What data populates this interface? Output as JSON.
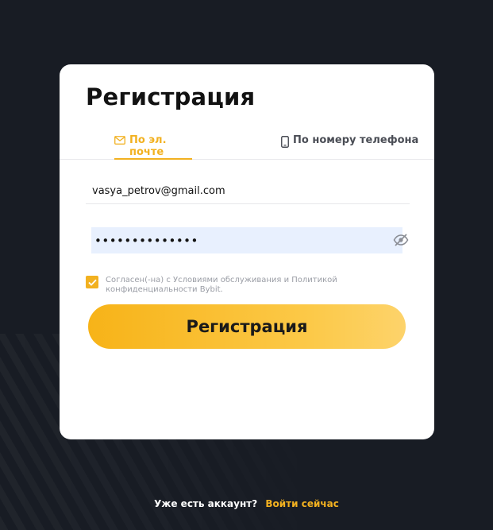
{
  "card": {
    "title": "Регистрация"
  },
  "tabs": [
    {
      "label": "По эл. почте",
      "icon": "envelope-icon",
      "active": true
    },
    {
      "label": "По номеру телефона",
      "icon": "phone-icon",
      "active": false
    }
  ],
  "form": {
    "email_value": "vasya_petrov@gmail.com",
    "password_value": "••••••••••••••",
    "agree_text": "Согласен(-на) с Условиями обслуживания и Политикой конфиденциальности Bybit.",
    "agree_checked": true,
    "submit_label": "Регистрация"
  },
  "footer": {
    "question": "Уже есть аккаунт?",
    "login_link": "Войти сейчас"
  },
  "colors": {
    "accent": "#f2b120",
    "background": "#181c24",
    "card": "#ffffff"
  }
}
